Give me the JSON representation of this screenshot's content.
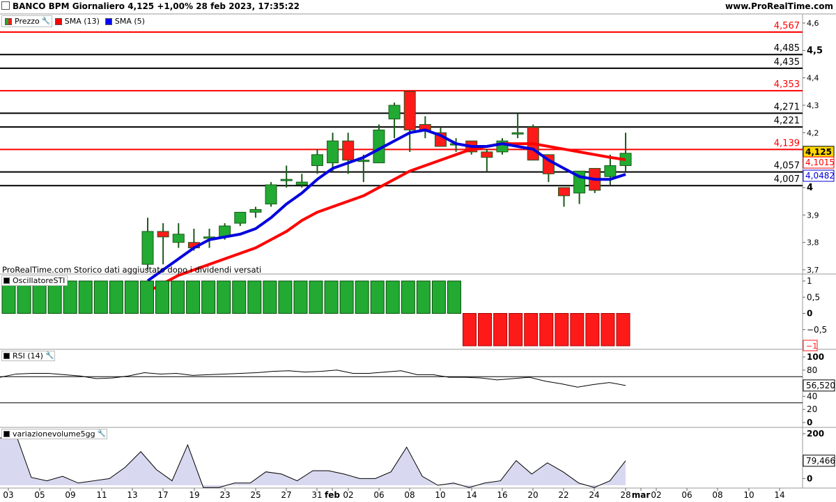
{
  "header": {
    "title": "BANCO BPM Giornaliero 4,125 +1,00% 28 feb 2023, 17:35:22",
    "site": "www.ProRealTime.com"
  },
  "legend": {
    "items": [
      {
        "label": "Prezzo",
        "color": "#22aa22",
        "icon": "candle-icon",
        "has_wrench": true
      },
      {
        "label": "SMA (13)",
        "color": "#ff0000",
        "icon": "red-square-icon"
      },
      {
        "label": "SMA (5)",
        "color": "#0000ff",
        "icon": "blue-square-icon"
      }
    ]
  },
  "note": "ProRealTime.com Storico dati aggiustato dopo i dividendi versati",
  "panels": {
    "sti": {
      "label": "OscillatoreSTI"
    },
    "rsi": {
      "label": "RSI (14)"
    },
    "vol": {
      "label": "variazionevolume5gg"
    }
  },
  "colors": {
    "up": "#22aa33",
    "down": "#ff1a1a",
    "wick": "#1a5a1a",
    "sma13": "#ff0000",
    "sma5": "#0000dd",
    "level_red": "#ff0000",
    "level_black": "#000000",
    "price_tag": "#ffd700"
  },
  "chart_data": [
    {
      "type": "candlestick",
      "title": "BANCO BPM Giornaliero",
      "ylim": [
        3.7,
        4.6
      ],
      "yticks": [
        "4,6",
        "4,5",
        "4,4",
        "4,3",
        "4,2",
        "4,1",
        "4",
        "3,9",
        "3,8",
        "3,7"
      ],
      "ytick_values": [
        4.6,
        4.5,
        4.4,
        4.3,
        4.2,
        4.1,
        4.0,
        3.9,
        3.8,
        3.7
      ],
      "x_labels": [
        "03",
        "05",
        "09",
        "11",
        "13",
        "17",
        "19",
        "23",
        "25",
        "27",
        "31",
        "feb",
        "02",
        "06",
        "08",
        "10",
        "14",
        "16",
        "20",
        "22",
        "24",
        "28",
        "mar",
        "02",
        "06",
        "08",
        "10",
        "14"
      ],
      "candles": [
        {
          "o": 3.72,
          "h": 3.89,
          "l": 3.7,
          "c": 3.84
        },
        {
          "o": 3.84,
          "h": 3.87,
          "l": 3.72,
          "c": 3.82
        },
        {
          "o": 3.8,
          "h": 3.87,
          "l": 3.78,
          "c": 3.83
        },
        {
          "o": 3.8,
          "h": 3.85,
          "l": 3.77,
          "c": 3.78
        },
        {
          "o": 3.82,
          "h": 3.85,
          "l": 3.78,
          "c": 3.82
        },
        {
          "o": 3.82,
          "h": 3.87,
          "l": 3.81,
          "c": 3.86
        },
        {
          "o": 3.87,
          "h": 3.91,
          "l": 3.86,
          "c": 3.91
        },
        {
          "o": 3.91,
          "h": 3.93,
          "l": 3.89,
          "c": 3.92
        },
        {
          "o": 3.94,
          "h": 4.02,
          "l": 3.93,
          "c": 4.01
        },
        {
          "o": 4.03,
          "h": 4.08,
          "l": 4.0,
          "c": 4.03
        },
        {
          "o": 4.01,
          "h": 4.05,
          "l": 4.0,
          "c": 4.02
        },
        {
          "o": 4.08,
          "h": 4.14,
          "l": 4.05,
          "c": 4.12
        },
        {
          "o": 4.09,
          "h": 4.2,
          "l": 4.06,
          "c": 4.17
        },
        {
          "o": 4.17,
          "h": 4.2,
          "l": 4.05,
          "c": 4.1
        },
        {
          "o": 4.1,
          "h": 4.12,
          "l": 4.02,
          "c": 4.1
        },
        {
          "o": 4.09,
          "h": 4.23,
          "l": 4.09,
          "c": 4.21
        },
        {
          "o": 4.25,
          "h": 4.31,
          "l": 4.18,
          "c": 4.3
        },
        {
          "o": 4.35,
          "h": 4.35,
          "l": 4.13,
          "c": 4.21
        },
        {
          "o": 4.23,
          "h": 4.26,
          "l": 4.18,
          "c": 4.21
        },
        {
          "o": 4.2,
          "h": 4.22,
          "l": 4.15,
          "c": 4.15
        },
        {
          "o": 4.16,
          "h": 4.18,
          "l": 4.13,
          "c": 4.16
        },
        {
          "o": 4.17,
          "h": 4.17,
          "l": 4.12,
          "c": 4.13
        },
        {
          "o": 4.13,
          "h": 4.14,
          "l": 4.06,
          "c": 4.11
        },
        {
          "o": 4.13,
          "h": 4.18,
          "l": 4.12,
          "c": 4.17
        },
        {
          "o": 4.2,
          "h": 4.27,
          "l": 4.18,
          "c": 4.2
        },
        {
          "o": 4.22,
          "h": 4.23,
          "l": 4.1,
          "c": 4.1
        },
        {
          "o": 4.12,
          "h": 4.12,
          "l": 4.02,
          "c": 4.05
        },
        {
          "o": 4.0,
          "h": 4.0,
          "l": 3.93,
          "c": 3.97
        },
        {
          "o": 3.98,
          "h": 4.06,
          "l": 3.94,
          "c": 4.06
        },
        {
          "o": 4.07,
          "h": 4.07,
          "l": 3.98,
          "c": 3.99
        },
        {
          "o": 4.04,
          "h": 4.12,
          "l": 4.01,
          "c": 4.08
        },
        {
          "o": 4.08,
          "h": 4.2,
          "l": 4.06,
          "c": 4.125
        }
      ],
      "series": [
        {
          "name": "SMA (13)",
          "values": [
            3.62,
            3.65,
            3.68,
            3.7,
            3.72,
            3.74,
            3.76,
            3.78,
            3.81,
            3.84,
            3.88,
            3.91,
            3.93,
            3.95,
            3.97,
            4.0,
            4.03,
            4.06,
            4.08,
            4.1,
            4.12,
            4.14,
            4.15,
            4.16,
            4.16,
            4.16,
            4.15,
            4.14,
            4.13,
            4.12,
            4.11,
            4.1015
          ],
          "last_label": "4,1015"
        },
        {
          "name": "SMA (5)",
          "values": [
            3.66,
            3.7,
            3.74,
            3.78,
            3.81,
            3.82,
            3.83,
            3.85,
            3.89,
            3.94,
            3.98,
            4.03,
            4.07,
            4.09,
            4.11,
            4.14,
            4.17,
            4.2,
            4.21,
            4.19,
            4.16,
            4.15,
            4.15,
            4.16,
            4.15,
            4.14,
            4.1,
            4.07,
            4.04,
            4.03,
            4.03,
            4.0482
          ],
          "last_label": "4,0482"
        }
      ],
      "levels": [
        {
          "value": 4.567,
          "label": "4,567",
          "color": "red"
        },
        {
          "value": 4.485,
          "label": "4,485",
          "color": "black"
        },
        {
          "value": 4.435,
          "label": "4,435",
          "color": "black"
        },
        {
          "value": 4.353,
          "label": "4,353",
          "color": "red"
        },
        {
          "value": 4.271,
          "label": "4,271",
          "color": "black"
        },
        {
          "value": 4.221,
          "label": "4,221",
          "color": "black"
        },
        {
          "value": 4.139,
          "label": "4,139",
          "color": "red"
        },
        {
          "value": 4.057,
          "label": "4,057",
          "color": "black"
        },
        {
          "value": 4.007,
          "label": "4,007",
          "color": "black"
        }
      ],
      "last_price": "4,125"
    },
    {
      "type": "bar",
      "title": "OscillatoreSTI",
      "ylim": [
        -1,
        1
      ],
      "yticks": [
        "1",
        "0,5",
        "0",
        "−0,5",
        "−1"
      ],
      "ytick_values": [
        1,
        0.5,
        0,
        -0.5,
        -1
      ],
      "values": [
        1,
        1,
        1,
        1,
        1,
        1,
        1,
        1,
        1,
        1,
        1,
        1,
        1,
        1,
        1,
        1,
        1,
        1,
        1,
        1,
        1,
        1,
        1,
        1,
        1,
        1,
        1,
        1,
        1,
        1,
        -1,
        -1,
        -1,
        -1,
        -1,
        -1,
        -1,
        -1,
        -1,
        -1,
        -1
      ],
      "last_label": "−1"
    },
    {
      "type": "line",
      "title": "RSI (14)",
      "ylim": [
        0,
        100
      ],
      "yticks": [
        "100",
        "80",
        "60",
        "40",
        "20",
        "0"
      ],
      "ytick_values": [
        100,
        80,
        60,
        40,
        20,
        0
      ],
      "levels": [
        70,
        30
      ],
      "values": [
        69,
        74,
        75,
        75,
        73,
        71,
        67,
        68,
        71,
        76,
        74,
        75,
        72,
        73,
        74,
        75,
        76,
        78,
        79,
        77,
        78,
        80,
        75,
        75,
        77,
        79,
        73,
        73,
        69,
        69,
        68,
        65,
        67,
        69,
        63,
        59,
        54,
        58,
        61,
        56.52
      ],
      "last_label": "56,520"
    },
    {
      "type": "area",
      "title": "variazionevolume5gg",
      "ylim": [
        -30,
        200
      ],
      "yticks": [
        "200",
        "0"
      ],
      "ytick_values": [
        200,
        0
      ],
      "values": [
        180,
        200,
        5,
        -10,
        10,
        -20,
        -10,
        0,
        50,
        120,
        40,
        -10,
        150,
        -40,
        -40,
        -20,
        -20,
        30,
        20,
        -10,
        35,
        35,
        20,
        0,
        0,
        30,
        140,
        10,
        -30,
        -20,
        -40,
        -20,
        -10,
        80,
        20,
        70,
        30,
        -20,
        -40,
        -10,
        79.466
      ],
      "last_label": "79,466"
    }
  ]
}
